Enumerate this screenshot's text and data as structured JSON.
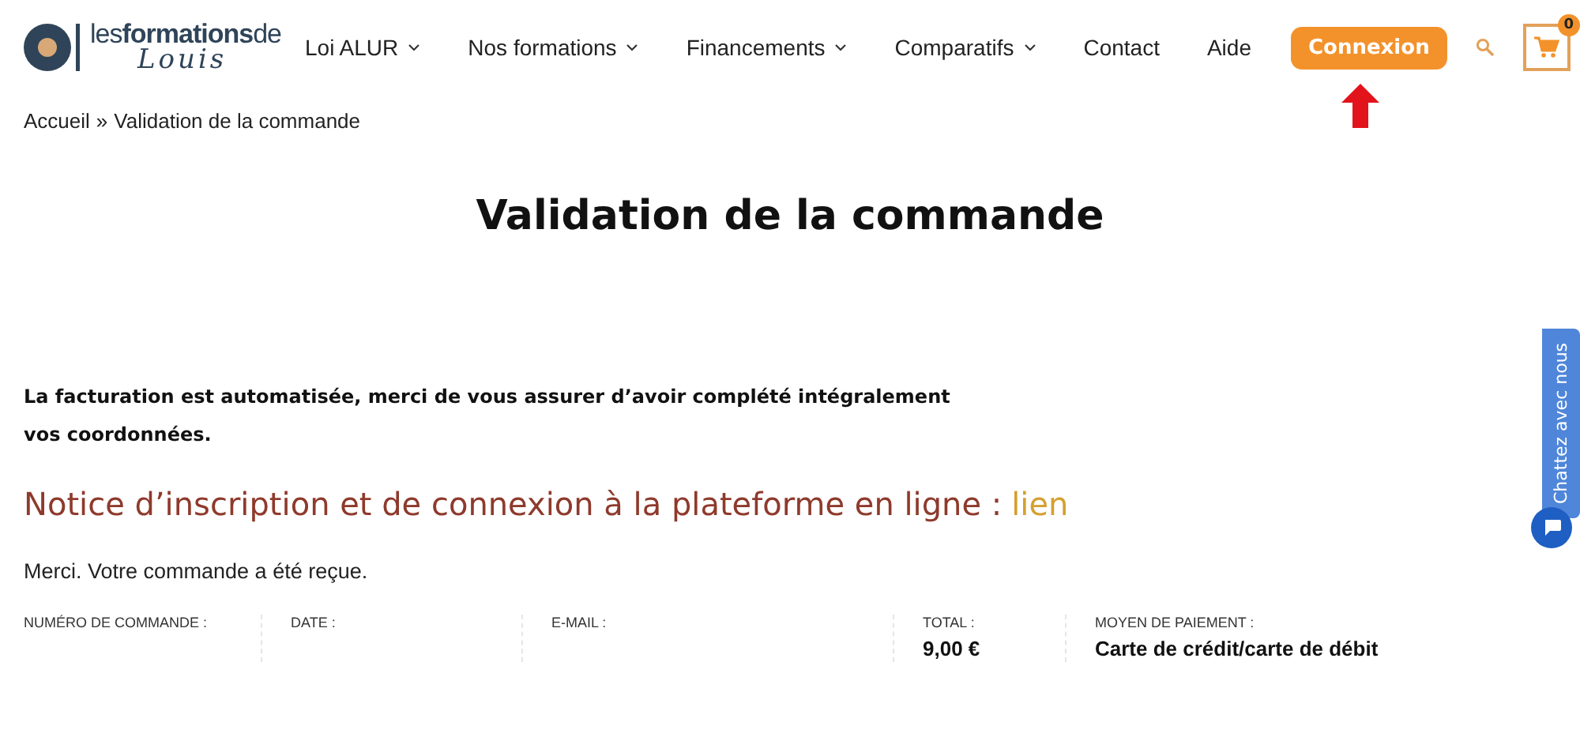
{
  "logo": {
    "brand": "les**formations**de",
    "signature": "Louis"
  },
  "nav": [
    {
      "label": "Loi ALUR",
      "dropdown": true
    },
    {
      "label": "Nos formations",
      "dropdown": true
    },
    {
      "label": "Financements",
      "dropdown": true
    },
    {
      "label": "Comparatifs",
      "dropdown": true
    },
    {
      "label": "Contact",
      "dropdown": false
    },
    {
      "label": "Aide",
      "dropdown": false
    }
  ],
  "login_button": "Connexion",
  "cart": {
    "count": "0"
  },
  "breadcrumb": {
    "home": "Accueil",
    "separator": "»",
    "current": "Validation de la commande"
  },
  "title": "Validation de la commande",
  "notice": "La facturation est automatisée, merci de vous assurer d’avoir complété intégralement vos coordonnées.",
  "instructions": {
    "text": "Notice d’inscription et de connexion à la plateforme en ligne :",
    "link": "lien"
  },
  "confirmation": "Merci. Votre commande a été reçue.",
  "order_details": [
    {
      "label": "NUMÉRO DE COMMANDE :"
    },
    {
      "label": "DATE :"
    },
    {
      "label": "E-MAIL :"
    },
    {
      "label": "TOTAL :",
      "value": "9,00 €"
    },
    {
      "label": "MOYEN DE PAIEMENT :",
      "value": "Carte de crédit/carte de débit"
    }
  ],
  "chat": {
    "label": "Chattez avec nous"
  }
}
